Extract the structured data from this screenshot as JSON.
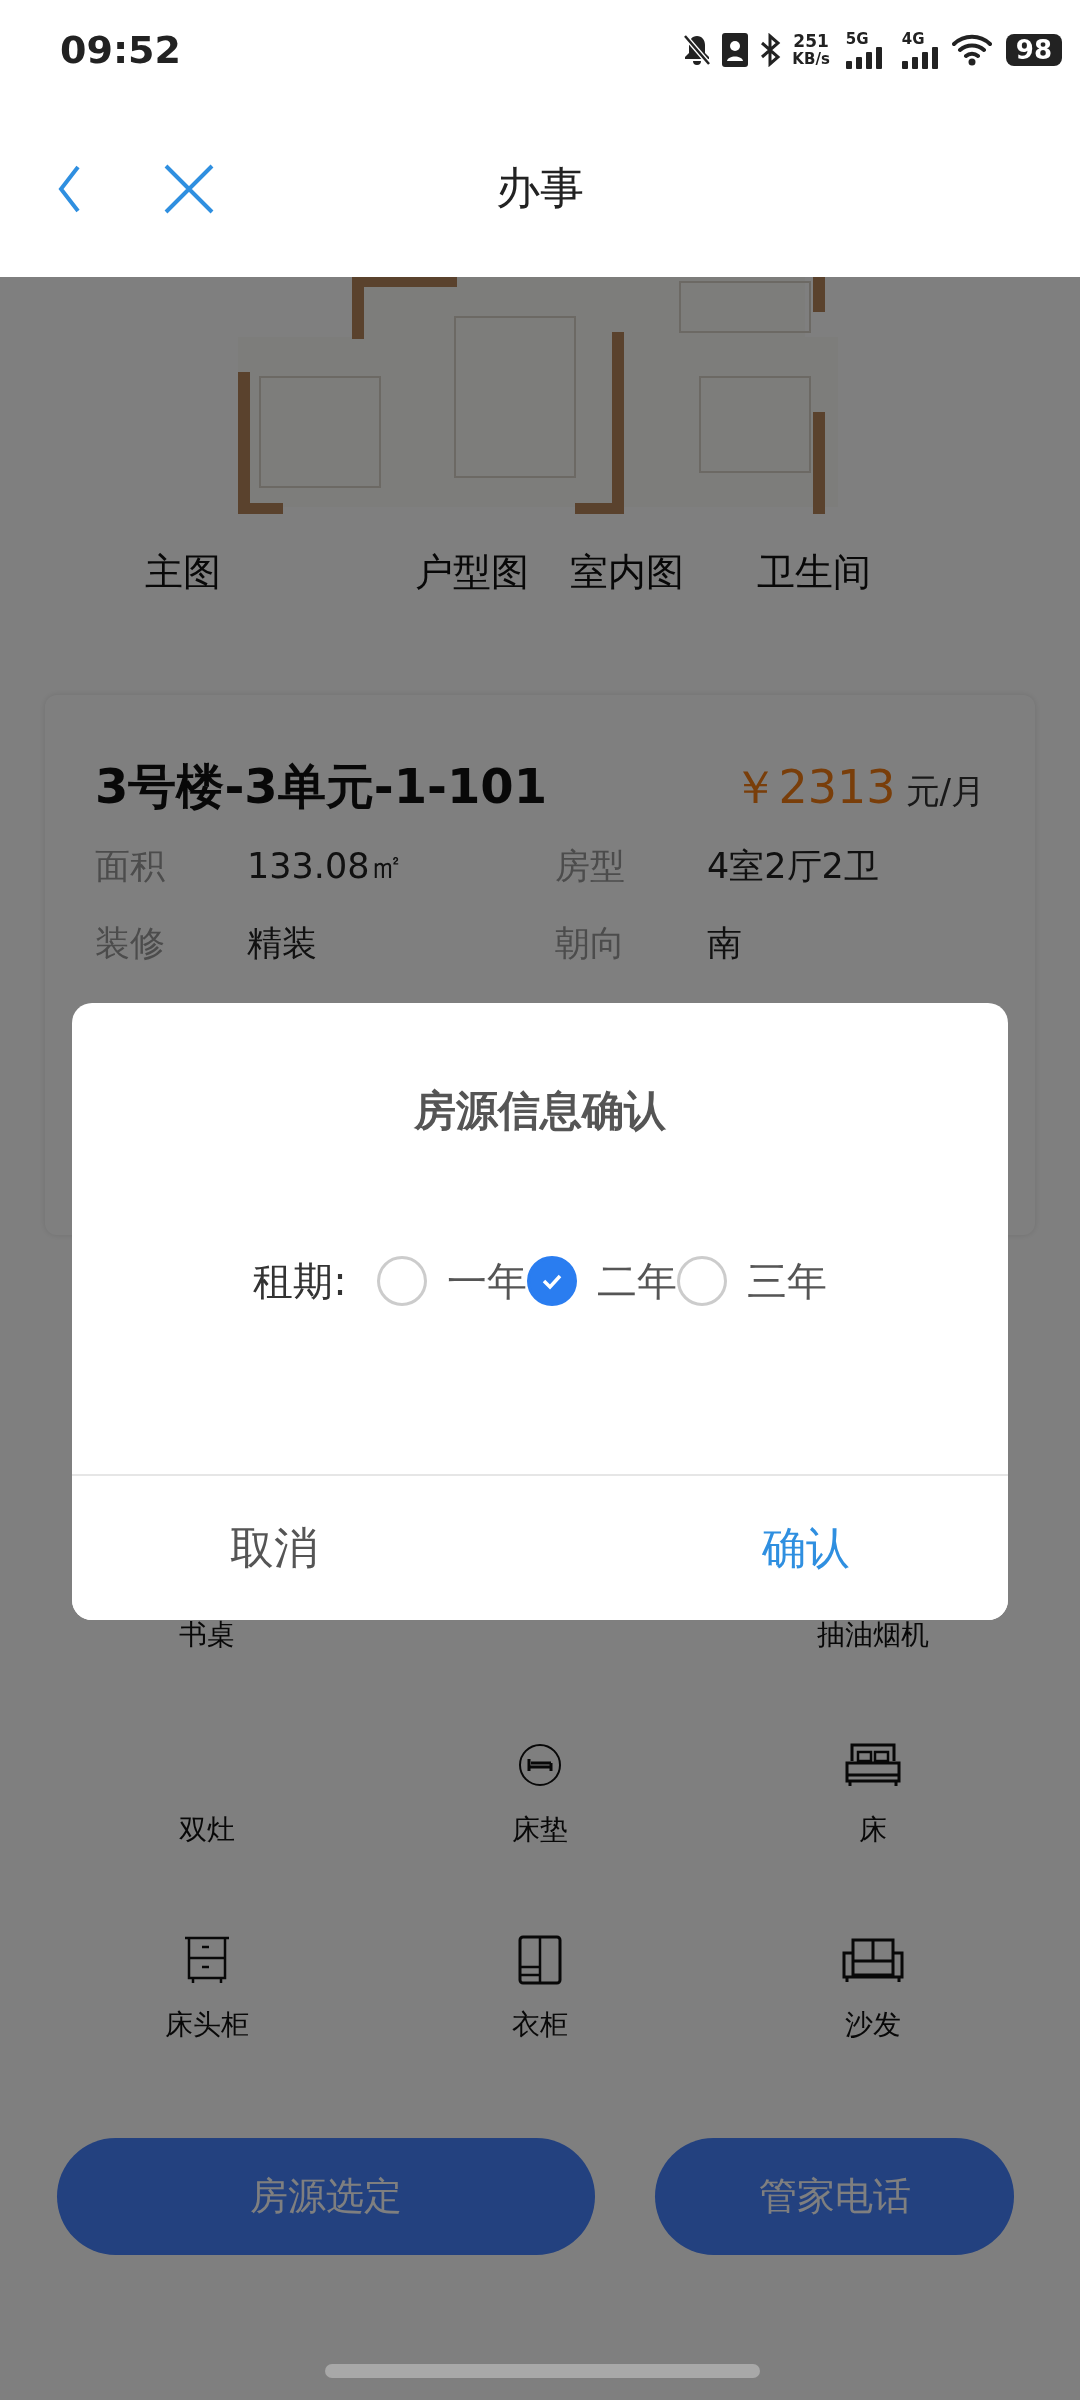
{
  "status_bar": {
    "time": "09:52",
    "net_speed": "251",
    "net_speed_unit": "KB/s",
    "signals": [
      {
        "label": "5G"
      },
      {
        "label": "4G"
      }
    ],
    "battery": "98"
  },
  "header": {
    "title": "办事"
  },
  "gallery": {
    "tabs": [
      {
        "label": "主图"
      },
      {
        "label": "户型图"
      },
      {
        "label": "室内图"
      },
      {
        "label": "卫生间"
      }
    ]
  },
  "listing": {
    "title": "3号楼-3单元-1-101",
    "price": "￥2313",
    "price_unit": "元/月",
    "specs": [
      {
        "label": "面积",
        "value": "133.08㎡"
      },
      {
        "label": "房型",
        "value": "4室2厅2卫"
      },
      {
        "label": "装修",
        "value": "精装"
      },
      {
        "label": "朝向",
        "value": "南"
      }
    ]
  },
  "amenities": [
    [
      {
        "name": "书桌",
        "kind": "plain"
      },
      {
        "name": "抽油烟机",
        "kind": "plain"
      }
    ],
    [
      {
        "name": "双灶",
        "kind": "plain"
      },
      {
        "name": "床垫",
        "kind": "mattress"
      },
      {
        "name": "床",
        "kind": "bed"
      }
    ],
    [
      {
        "name": "床头柜",
        "kind": "nightstand"
      },
      {
        "name": "衣柜",
        "kind": "wardrobe"
      },
      {
        "name": "沙发",
        "kind": "sofa"
      }
    ]
  ],
  "actions": [
    {
      "label": "房源选定"
    },
    {
      "label": "管家电话"
    }
  ],
  "lease_dialog": {
    "title": "房源信息确认",
    "label": "租期:",
    "options": [
      {
        "label": "一年",
        "selected": false
      },
      {
        "label": "二年",
        "selected": true
      },
      {
        "label": "三年",
        "selected": false
      }
    ],
    "buttons": [
      {
        "label": "取消",
        "kind": "cancel"
      },
      {
        "label": "确认",
        "kind": "confirm"
      }
    ]
  }
}
